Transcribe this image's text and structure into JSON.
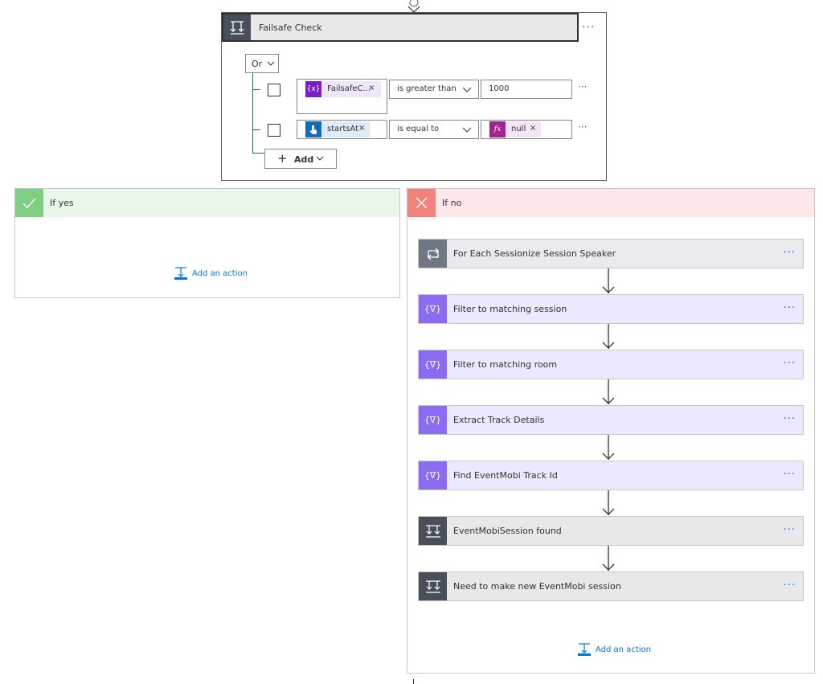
{
  "condition": {
    "title": "Failsafe Check",
    "more_label": "···",
    "group_operator": "Or",
    "rows": [
      {
        "left_token": "FailsafeC...",
        "left_token_icon": "{x}",
        "operator": "is greater than",
        "right_value": "1000"
      },
      {
        "left_token": "startsAt",
        "operator": "is equal to",
        "right_token_icon": "fx",
        "right_token": "null"
      }
    ],
    "row_more": "···",
    "add_label": "Add"
  },
  "if_yes": {
    "title": "If yes",
    "add_action": "Add an action"
  },
  "if_no": {
    "title": "If no",
    "add_action": "Add an action",
    "actions": [
      {
        "title": "For Each Sessionize Session Speaker",
        "icon": "loop-icon"
      },
      {
        "title": "Filter to matching session",
        "icon": "filter-array-icon"
      },
      {
        "title": "Filter to matching room",
        "icon": "filter-array-icon"
      },
      {
        "title": "Extract Track Details",
        "icon": "filter-array-icon"
      },
      {
        "title": "Find EventMobi Track Id",
        "icon": "filter-array-icon"
      },
      {
        "title": "EventMobiSession found",
        "icon": "condition-icon"
      },
      {
        "title": "Need to make new EventMobi session",
        "icon": "condition-icon"
      }
    ],
    "more_label": "···"
  },
  "colors": {
    "accent": "#0078d4",
    "yes_header": "#e9f6ea",
    "yes_icon": "#7ecf83",
    "no_header": "#fde7e9",
    "no_icon": "#f2837c",
    "loop": "#6f7882",
    "filter": "#8b6cf0",
    "filter_header": "#ece8fd",
    "condition": "#484f58",
    "condition_header": "#e8e8e8"
  }
}
